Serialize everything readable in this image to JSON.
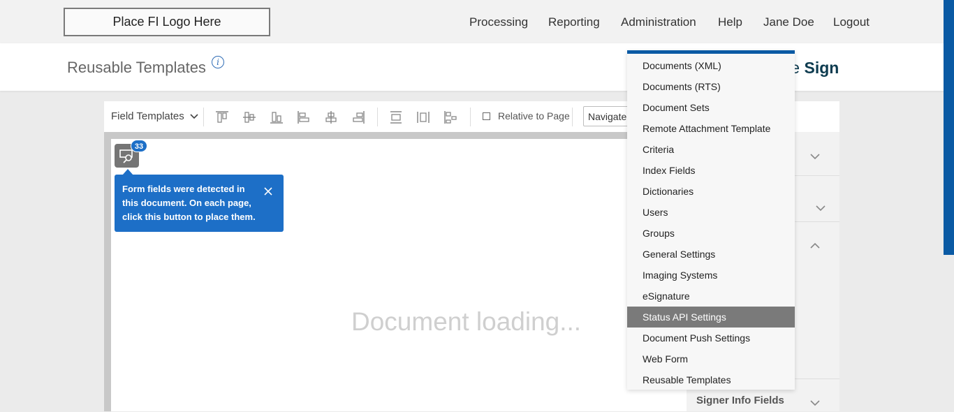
{
  "header": {
    "logo_text": "Place FI Logo Here",
    "nav": [
      "Processing",
      "Reporting",
      "Administration",
      "Help",
      "Jane Doe",
      "Logout"
    ]
  },
  "subheader": {
    "title": "Reusable Templates",
    "info_icon": "info-icon",
    "brand_prefix": "ective",
    "brand_bold": "Sign"
  },
  "toolbar": {
    "field_templates_label": "Field Templates",
    "relative_to_page_label": "Relative to Page",
    "relative_to_page_checked": false,
    "navigate_value": "Navigate t"
  },
  "document": {
    "loading_text": "Document loading...",
    "detected_form_count": "33",
    "tooltip_text": "Form fields were detected in this document. On each page, click this button to place them."
  },
  "right_panel": {
    "signer_info_label": "Signer Info Fields"
  },
  "admin_menu": {
    "items": [
      "Documents (XML)",
      "Documents (RTS)",
      "Document Sets",
      "Remote Attachment Template",
      "Criteria",
      "Index Fields",
      "Dictionaries",
      "Users",
      "Groups",
      "General Settings",
      "Imaging Systems",
      "eSignature",
      "Status API Settings",
      "Document Push Settings",
      "Web Form",
      "Reusable Templates"
    ],
    "highlighted": "Status API Settings"
  },
  "colors": {
    "accent_blue": "#0a5aa4",
    "tooltip_blue": "#1d6fc7",
    "brand_dark": "#0d3b4f",
    "menu_highlight": "#7a7a7a"
  }
}
